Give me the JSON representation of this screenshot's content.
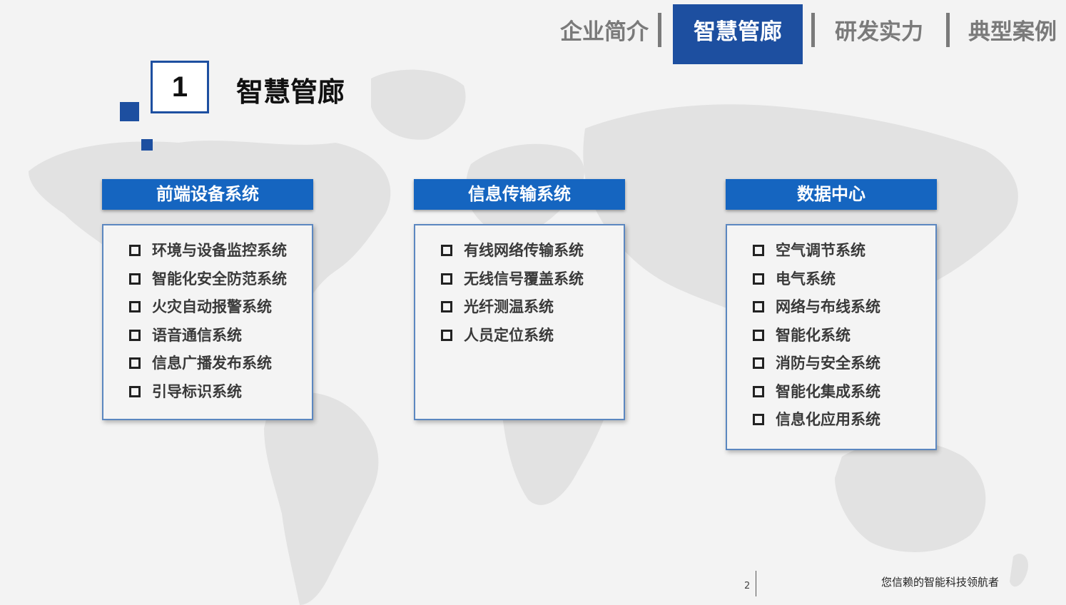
{
  "nav": {
    "items": [
      {
        "label": "企业简介"
      },
      {
        "label": "智慧管廊"
      },
      {
        "label": "研发实力"
      },
      {
        "label": "典型案例"
      }
    ],
    "active_index": 1
  },
  "section": {
    "number": "1",
    "title": "智慧管廊"
  },
  "cards": [
    {
      "title": "前端设备系统",
      "items": [
        "环境与设备监控系统",
        "智能化安全防范系统",
        "火灾自动报警系统",
        "语音通信系统",
        "信息广播发布系统",
        "引导标识系统"
      ]
    },
    {
      "title": "信息传输系统",
      "items": [
        "有线网络传输系统",
        "无线信号覆盖系统",
        "光纤测温系统",
        "人员定位系统"
      ]
    },
    {
      "title": "数据中心",
      "items": [
        "空气调节系统",
        "电气系统",
        "网络与布线系统",
        "智能化系统",
        "消防与安全系统",
        "智能化集成系统",
        "信息化应用系统"
      ]
    }
  ],
  "footer": {
    "page_number": "2",
    "slogan": "您信赖的智能科技领航者"
  },
  "colors": {
    "accent": "#1d4fa0",
    "card_header": "#1565c0",
    "background": "#f3f3f3"
  }
}
